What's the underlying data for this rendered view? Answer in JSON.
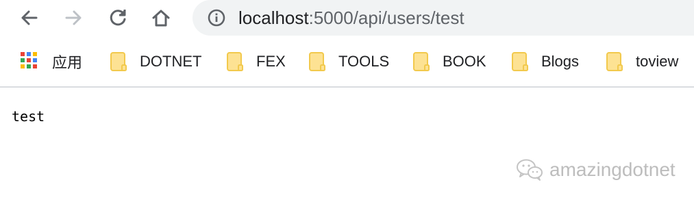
{
  "toolbar": {
    "url_host": "localhost",
    "url_rest": ":5000/api/users/test",
    "icons": [
      "back-icon",
      "forward-icon",
      "reload-icon",
      "home-icon",
      "info-icon"
    ]
  },
  "bookmarks": {
    "apps_label": "应用",
    "items": [
      {
        "label": "DOTNET"
      },
      {
        "label": "FEX"
      },
      {
        "label": "TOOLS"
      },
      {
        "label": "BOOK"
      },
      {
        "label": "Blogs"
      },
      {
        "label": "toview"
      }
    ],
    "apps_colors": [
      "#ea4335",
      "#4285f4",
      "#fbbc05",
      "#34a853",
      "#ea4335",
      "#4285f4",
      "#fbbc05",
      "#34a853",
      "#ea4335"
    ],
    "folder_color": "#fde293"
  },
  "page": {
    "body_text": "test"
  },
  "watermark": {
    "text": "amazingdotnet"
  }
}
